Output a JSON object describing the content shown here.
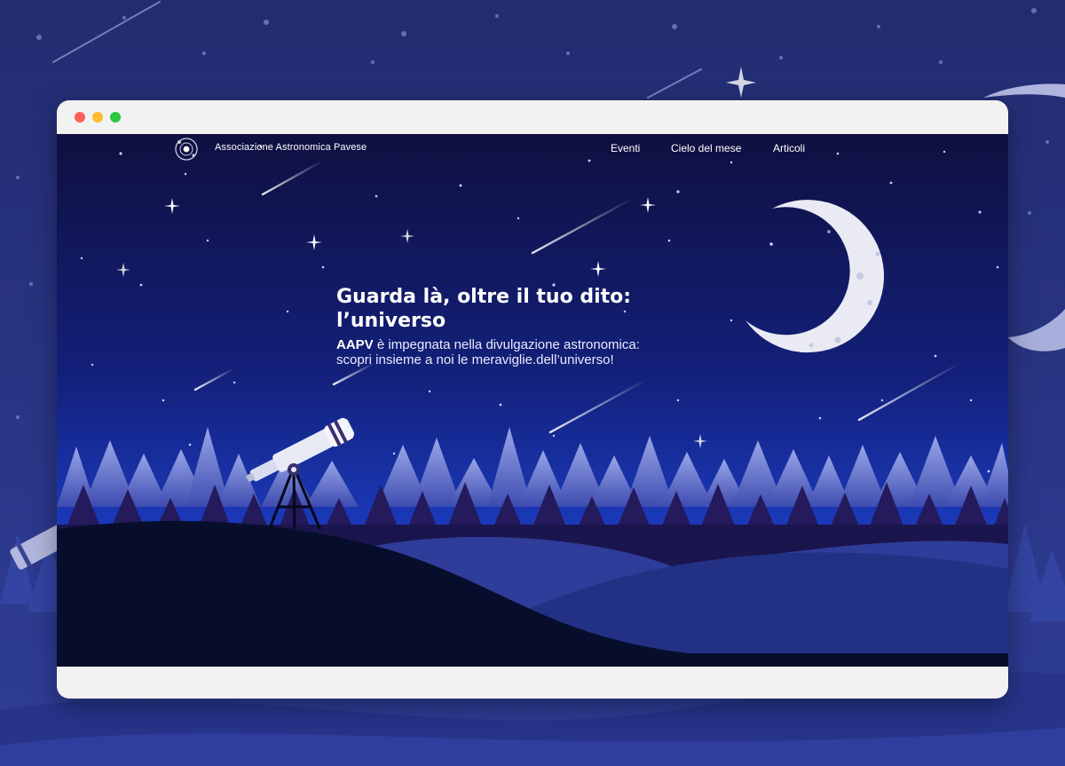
{
  "window": {
    "controls": [
      "close",
      "minimize",
      "maximize"
    ]
  },
  "site": {
    "logo_icon": "orbit-logo-icon",
    "brand_name": "Associazione Astronomica Pavese",
    "nav": [
      {
        "label": "Eventi"
      },
      {
        "label": "Cielo del mese"
      },
      {
        "label": "Articoli"
      }
    ]
  },
  "hero": {
    "title_line1": "Guarda là, oltre il tuo dito:",
    "title_line2": "l’universo",
    "text_strong": "AAPV",
    "text_rest1": " è impegnata nella divulgazione astronomica:",
    "text_rest2": "scopri insieme a noi le meraviglie.dell’universo!"
  },
  "illustration": {
    "elements": [
      "crescent-moon",
      "telescope",
      "pine-forest",
      "hills",
      "shooting-stars",
      "stars"
    ]
  },
  "colors": {
    "page_background": "#2a3686",
    "sky_top": "#0f1040",
    "sky_bottom": "#1c3fc8",
    "hill_dark": "#060e2c",
    "hill_blue": "#2e3f99"
  }
}
